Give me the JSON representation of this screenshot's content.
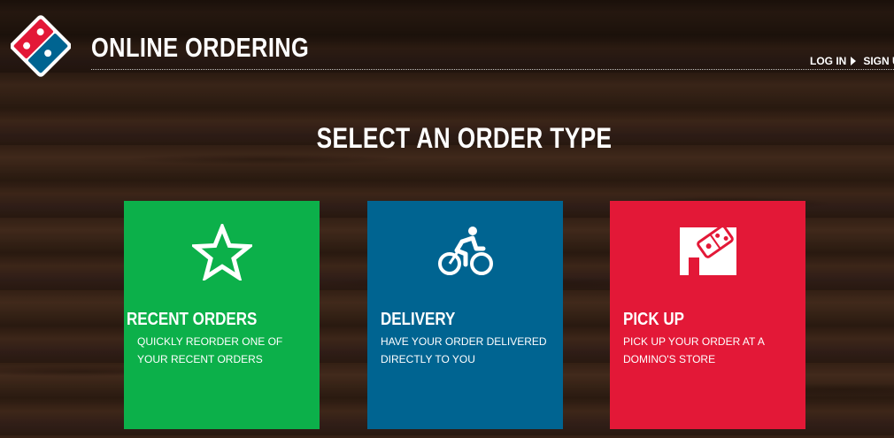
{
  "brand": {
    "title": "ONLINE ORDERING",
    "logo_icon": "dominos-domino-logo-icon",
    "colors": {
      "logo_red": "#e31837",
      "logo_blue": "#006491"
    }
  },
  "auth": {
    "login_label": "LOG IN",
    "signup_label": "SIGN U"
  },
  "main": {
    "heading": "SELECT AN ORDER TYPE"
  },
  "order_types": [
    {
      "title": "RECENT ORDERS",
      "description": "QUICKLY REORDER ONE OF YOUR RECENT ORDERS",
      "icon": "star-icon",
      "color": "#0cb04a"
    },
    {
      "title": "DELIVERY",
      "description": "HAVE YOUR ORDER DELIVERED DIRECTLY TO YOU",
      "icon": "bicycle-rider-icon",
      "color": "#006491"
    },
    {
      "title": "PICK UP",
      "description": "PICK UP YOUR ORDER AT A DOMINO'S STORE",
      "icon": "store-icon",
      "color": "#e31837"
    }
  ]
}
